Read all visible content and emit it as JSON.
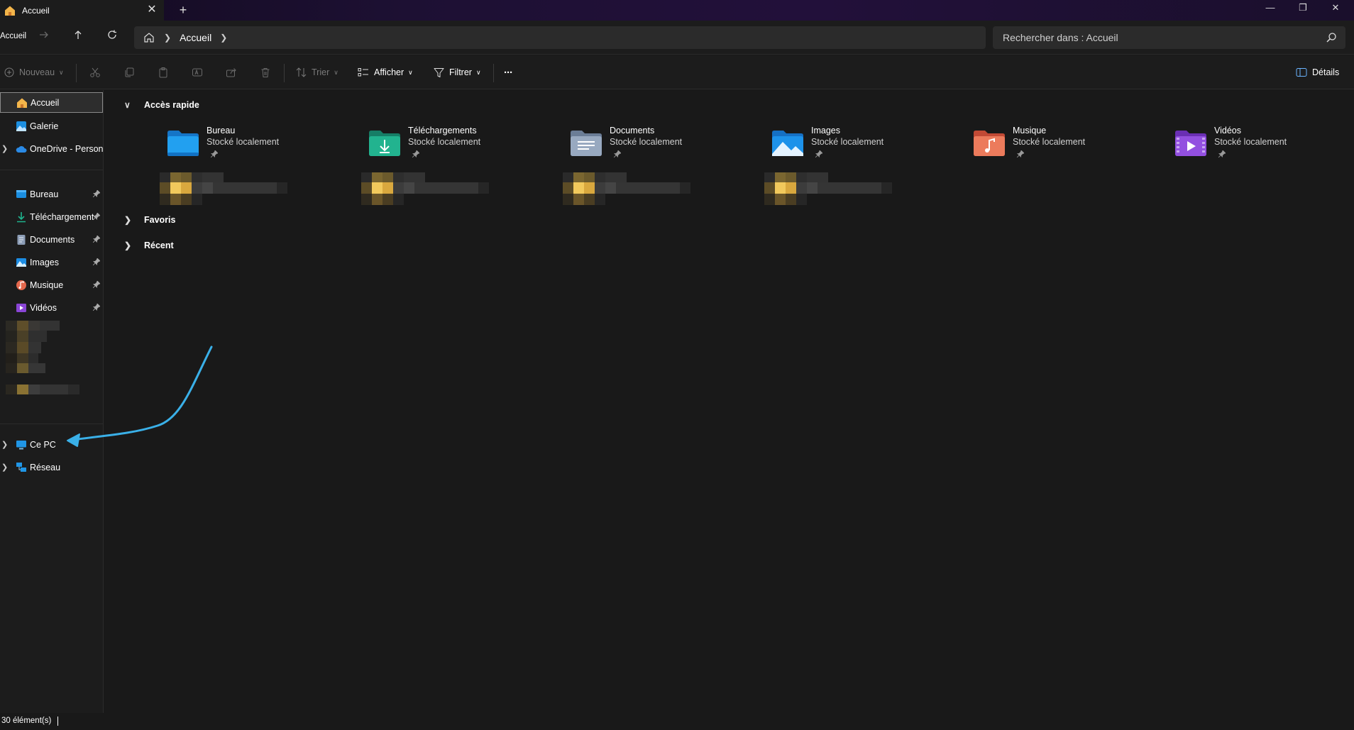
{
  "window": {
    "tab_title": "Accueil",
    "close_tab": "✕",
    "new_tab": "+",
    "minimize": "—",
    "maximize": "❐",
    "close": "✕"
  },
  "address": {
    "back_label": "Accueil",
    "breadcrumb": "Accueil",
    "search_placeholder": "Rechercher dans : Accueil"
  },
  "toolbar": {
    "new_label": "Nouveau",
    "sort_label": "Trier",
    "view_label": "Afficher",
    "filter_label": "Filtrer",
    "more_label": "···",
    "details_label": "Détails"
  },
  "sidebar": {
    "items": [
      {
        "label": "Accueil"
      },
      {
        "label": "Galerie"
      },
      {
        "label": "OneDrive - Persona"
      },
      {
        "label": "Bureau"
      },
      {
        "label": "Téléchargement"
      },
      {
        "label": "Documents"
      },
      {
        "label": "Images"
      },
      {
        "label": "Musique"
      },
      {
        "label": "Vidéos"
      },
      {
        "label": "Ce PC"
      },
      {
        "label": "Réseau"
      }
    ]
  },
  "main": {
    "quick_access_label": "Accès rapide",
    "favorites_label": "Favoris",
    "recent_label": "Récent",
    "folders": [
      {
        "name": "Bureau",
        "sub": "Stocké localement",
        "icon": "desktop-folder-icon",
        "color": "#1b8ee0"
      },
      {
        "name": "Téléchargements",
        "sub": "Stocké localement",
        "icon": "downloads-folder-icon",
        "color": "#1fa383"
      },
      {
        "name": "Documents",
        "sub": "Stocké localement",
        "icon": "documents-folder-icon",
        "color": "#8c9db6"
      },
      {
        "name": "Images",
        "sub": "Stocké localement",
        "icon": "pictures-folder-icon",
        "color": "#1c8de4"
      },
      {
        "name": "Musique",
        "sub": "Stocké localement",
        "icon": "music-folder-icon",
        "color": "#e4674c"
      },
      {
        "name": "Vidéos",
        "sub": "Stocké localement",
        "icon": "videos-folder-icon",
        "color": "#8a45d6"
      }
    ]
  },
  "status": {
    "count": "30 élément(s)"
  },
  "annotation": {
    "color": "#3ab0e8"
  }
}
